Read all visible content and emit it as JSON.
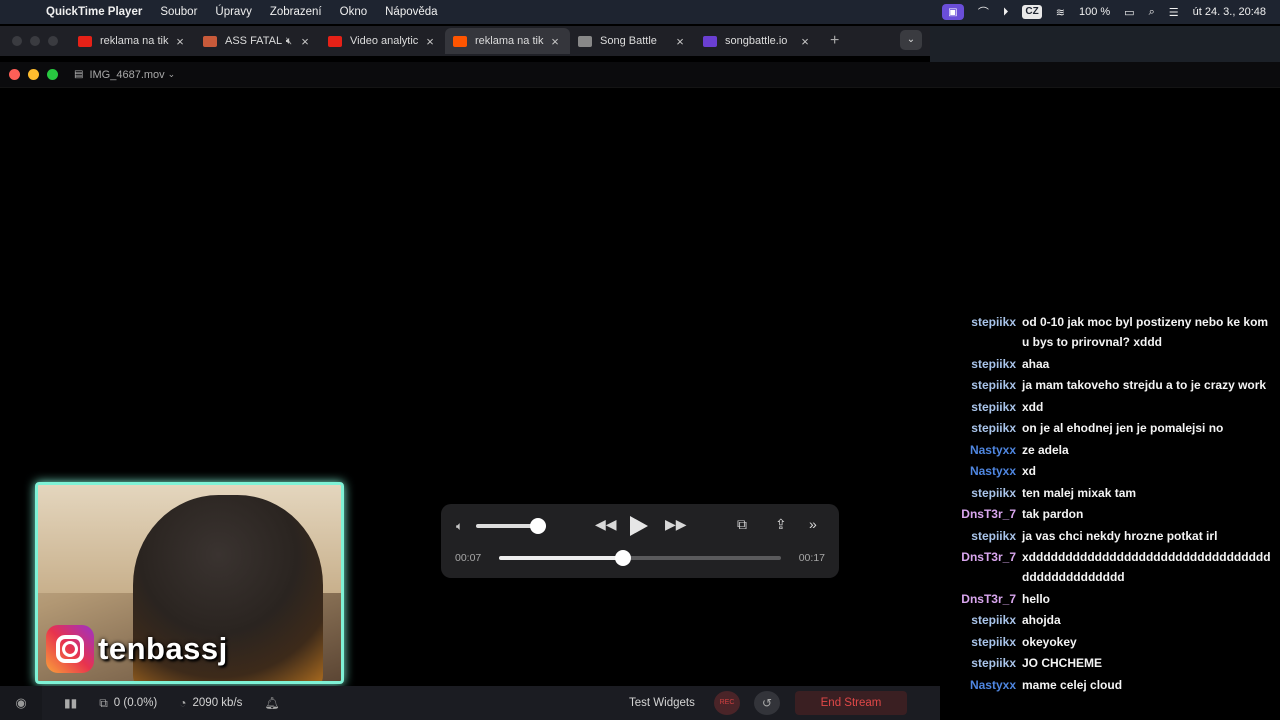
{
  "menubar": {
    "apple": "",
    "items": [
      "QuickTime Player",
      "Soubor",
      "Úpravy",
      "Zobrazení",
      "Okno",
      "Nápověda"
    ],
    "keyboard_layout": "CZ",
    "battery": "100 %",
    "datetime": "út 24. 3.,  20:48"
  },
  "browser": {
    "tabs": [
      {
        "label": "reklama na tik",
        "favicon_color": "#e62117",
        "active": false
      },
      {
        "label": "ASS FATAL",
        "favicon_color": "#c85a3a",
        "active": false,
        "muted": true
      },
      {
        "label": "Video analytic",
        "favicon_color": "#e62117",
        "active": false
      },
      {
        "label": "reklama na tik",
        "favicon_color": "#ff5500",
        "active": true
      },
      {
        "label": "Song Battle",
        "favicon_color": "#888888",
        "active": false
      },
      {
        "label": "songbattle.io",
        "favicon_color": "#6a3fd1",
        "active": false
      }
    ],
    "new_tab": "+",
    "tab_menu": "⌄"
  },
  "player": {
    "filename": "IMG_4687.mov",
    "time_elapsed": "00:07",
    "time_total": "00:17",
    "progress_fraction": 0.44,
    "volume_fraction": 0.88
  },
  "overlay": {
    "instagram_handle": "tenbassj"
  },
  "colors": {
    "user_stepiikx": "#a9c4ea",
    "user_nastyxx": "#4f86e0",
    "user_dnst3r": "#d9a6ee",
    "cam_border": "#7ff2d6"
  },
  "chat": [
    {
      "user": "stepiikx",
      "text": "od 0-10 jak moc byl postizeny nebo ke komu bys to prirovnal? xddd",
      "color": "#a9c4ea"
    },
    {
      "user": "stepiikx",
      "text": "ahaa",
      "color": "#a9c4ea"
    },
    {
      "user": "stepiikx",
      "text": "ja mam takoveho strejdu a to je crazy work",
      "color": "#a9c4ea"
    },
    {
      "user": "stepiikx",
      "text": "xdd",
      "color": "#a9c4ea"
    },
    {
      "user": "stepiikx",
      "text": "on je al ehodnej jen je pomalejsi no",
      "color": "#a9c4ea"
    },
    {
      "user": "Nastyxx",
      "text": "ze adela",
      "color": "#4f86e0"
    },
    {
      "user": "Nastyxx",
      "text": "xd",
      "color": "#4f86e0"
    },
    {
      "user": "stepiikx",
      "text": "ten malej mixak tam",
      "color": "#a9c4ea"
    },
    {
      "user": "DnsT3r_7",
      "text": "tak pardon",
      "color": "#d9a6ee"
    },
    {
      "user": "stepiikx",
      "text": "ja vas chci nekdy hrozne potkat irl",
      "color": "#a9c4ea"
    },
    {
      "user": "DnsT3r_7",
      "text": "xddddddddddddddddddddddddddddddddddddddddddddddd",
      "color": "#d9a6ee"
    },
    {
      "user": "DnsT3r_7",
      "text": "hello",
      "color": "#d9a6ee"
    },
    {
      "user": "stepiikx",
      "text": "ahojda",
      "color": "#a9c4ea"
    },
    {
      "user": "stepiikx",
      "text": "okeyokey",
      "color": "#a9c4ea"
    },
    {
      "user": "stepiikx",
      "text": "JO CHCHEME",
      "color": "#a9c4ea"
    },
    {
      "user": "Nastyxx",
      "text": "mame celej cloud",
      "color": "#4f86e0"
    }
  ],
  "obs": {
    "dropped_frames": "0 (0.0%)",
    "bitrate": "2090 kb/s",
    "test_widgets": "Test Widgets",
    "rec_label": "REC",
    "end_stream": "End Stream"
  }
}
